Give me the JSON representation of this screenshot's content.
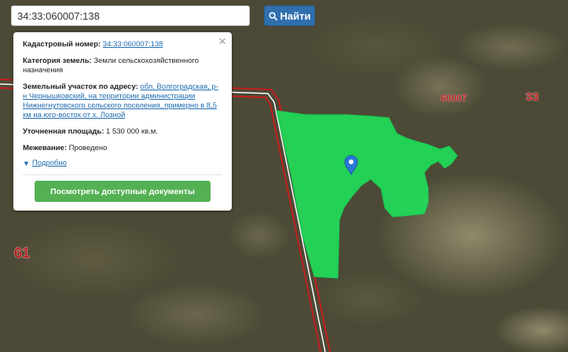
{
  "search": {
    "query": "34:33:060007:138",
    "button_label": "Найти"
  },
  "popup": {
    "close_symbol": "×",
    "cadastral_label": "Кадастровый номер:",
    "cadastral_value": "34:33:060007:138",
    "category_label": "Категория земель:",
    "category_value": "Земли сельскохозяйственного назначения",
    "address_label": "Земельный участок по адресу:",
    "address_value": "обл. Волгоградская, р-н Чернышковский, на территории администрации Нижнегнутовского сельского поселения, примерно в 8,5 км на юго-восток от х. Лозной",
    "area_label": "Уточненная площадь:",
    "area_value": "1 530 000 кв.м.",
    "survey_label": "Межевание:",
    "survey_value": "Проведено",
    "details_link": "Подробно",
    "docs_button": "Посмотреть доступные документы"
  },
  "map": {
    "labels": {
      "quarter": "60007",
      "district": "33",
      "neighbor": "61"
    },
    "colors": {
      "parcel": "#1ee05a",
      "boundary": "#c21f1f",
      "marker": "#2a78d8",
      "label": "#b51f1f"
    }
  }
}
